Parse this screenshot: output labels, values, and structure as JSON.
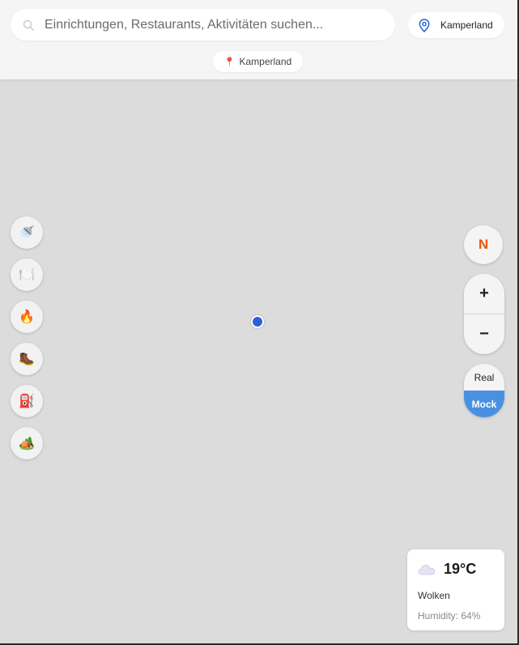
{
  "search": {
    "placeholder": "Einrichtungen, Restaurants, Aktivitäten suchen...",
    "icon": "search-icon"
  },
  "location_button": {
    "label": "Kamperland",
    "icon": "location-pin-icon"
  },
  "location_chip": {
    "label": "Kamperland",
    "icon": "📍"
  },
  "categories": [
    {
      "name": "showers",
      "icon": "🚿"
    },
    {
      "name": "restaurants",
      "icon": "🍽️"
    },
    {
      "name": "campfire",
      "icon": "🔥"
    },
    {
      "name": "hiking",
      "icon": "🥾"
    },
    {
      "name": "fuel",
      "icon": "⛽"
    },
    {
      "name": "camping",
      "icon": "🏕️"
    }
  ],
  "compass": {
    "label": "N",
    "color": "#e8590c"
  },
  "zoom": {
    "in_label": "+",
    "out_label": "−"
  },
  "mode_toggle": {
    "real_label": "Real",
    "mock_label": "Mock",
    "active": "Mock",
    "active_color": "#4a90e2"
  },
  "weather": {
    "icon": "☁️",
    "temperature": "19°C",
    "condition": "Wolken",
    "humidity": "Humidity: 64%"
  },
  "user_location_color": "#2a62d6",
  "map_background": "#dcdcdc"
}
